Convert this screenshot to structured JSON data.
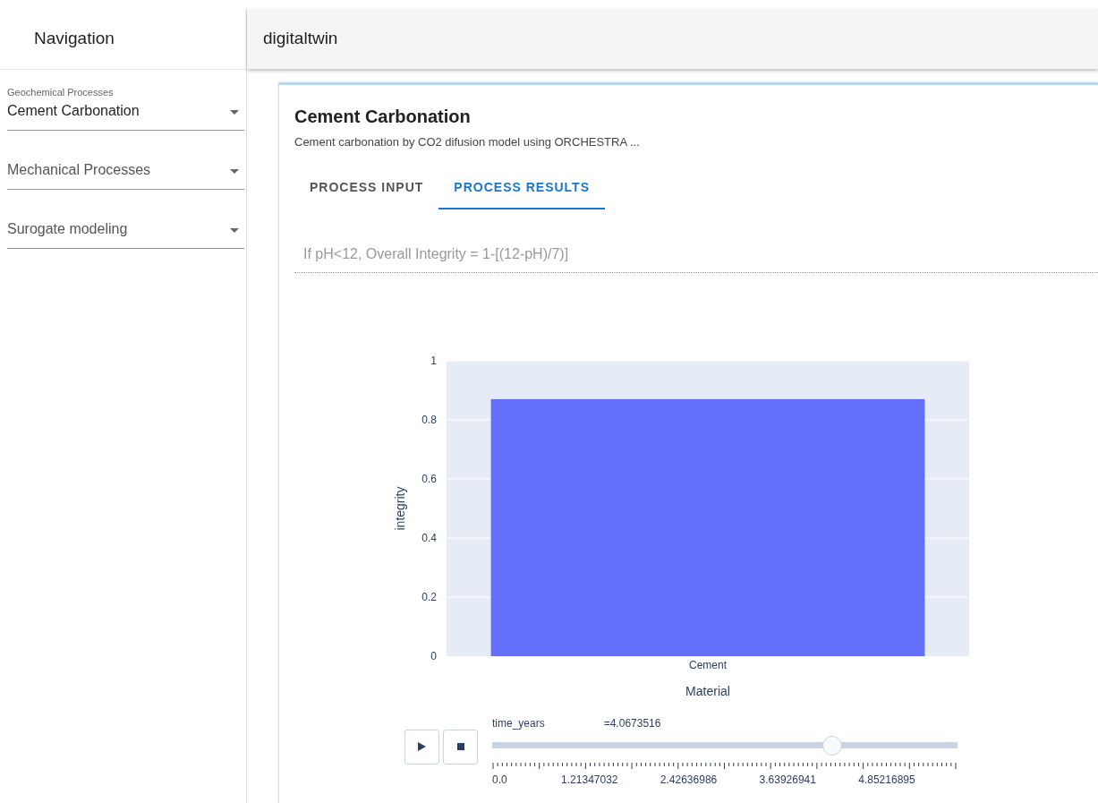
{
  "sidebar": {
    "title": "Navigation",
    "dropdowns": [
      {
        "label": "Geochemical Processes",
        "value": "Cement Carbonation"
      },
      {
        "value": "Mechanical Processes"
      },
      {
        "value": "Surogate modeling"
      }
    ]
  },
  "app_bar": {
    "title": "digitaltwin"
  },
  "card": {
    "title": "Cement Carbonation",
    "subtitle": "Cement carbonation by CO2 difusion model using ORCHESTRA ...",
    "tabs": [
      {
        "label": "PROCESS INPUT",
        "selected": false
      },
      {
        "label": "PROCESS RESULTS",
        "selected": true
      }
    ],
    "formula": "If pH<12, Overall Integrity = 1-[(12-pH)/7)]",
    "chart_data": {
      "type": "bar",
      "xlabel": "Material",
      "ylabel": "integrity",
      "categories": [
        "Cement"
      ],
      "values": [
        0.87
      ],
      "ylim": [
        0,
        1
      ],
      "yticks": [
        0,
        0.2,
        0.4,
        0.6,
        0.8,
        1
      ],
      "color": "#636efa",
      "grid": true
    },
    "animation": {
      "label": "time_years",
      "value": "=4.0673516",
      "level": 0.73,
      "tick_labels": [
        "0.0",
        "1.21347032",
        "2.42636986",
        "3.63926941",
        "4.85216895"
      ]
    }
  }
}
